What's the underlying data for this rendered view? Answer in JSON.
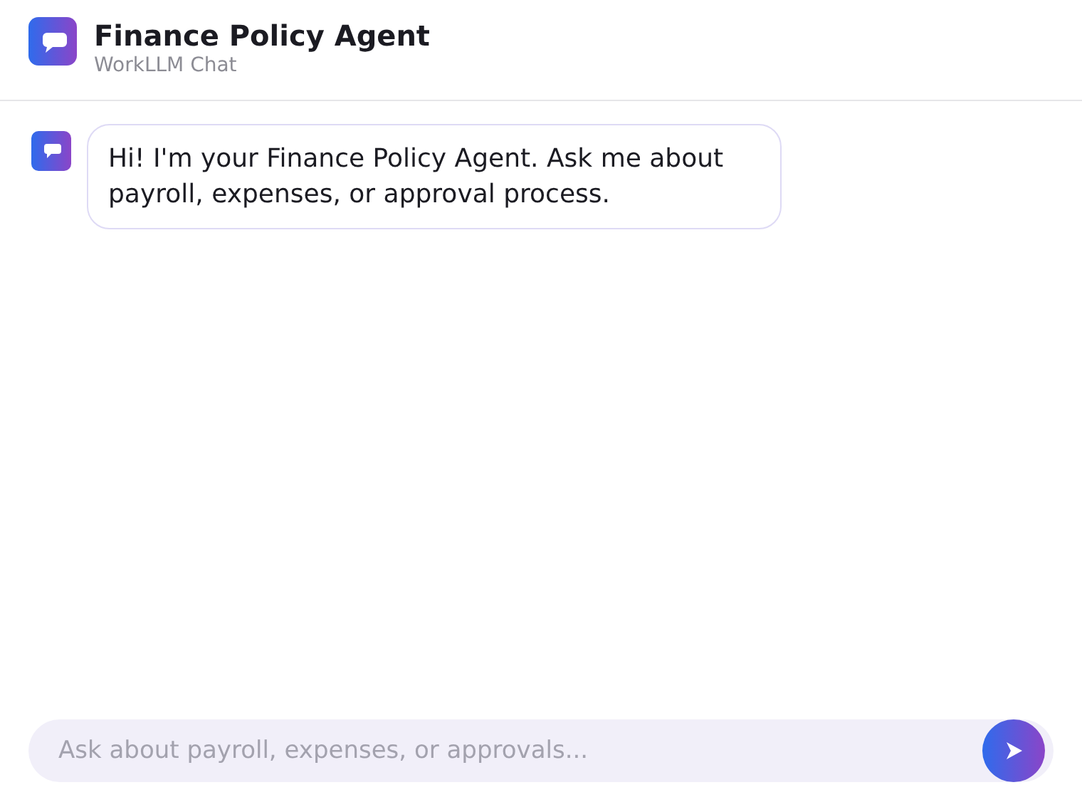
{
  "header": {
    "title": "Finance Policy Agent",
    "subtitle": "WorkLLM Chat"
  },
  "messages": [
    {
      "kind": "agent",
      "text": "Hi! I'm your Finance Policy Agent. Ask me about payroll, expenses, or approval process."
    }
  ],
  "composer": {
    "placeholder": "Ask about payroll, expenses, or approvals..."
  }
}
